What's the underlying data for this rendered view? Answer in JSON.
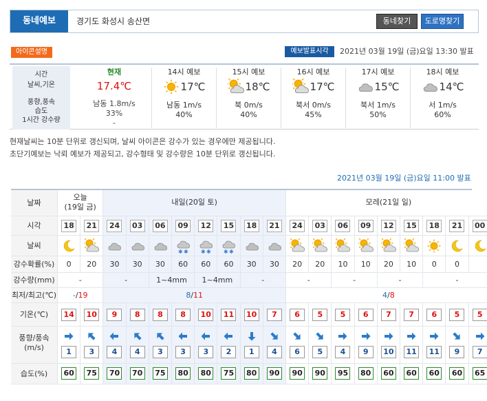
{
  "header": {
    "label": "동네예보",
    "location": "경기도 화성시 송산면",
    "btn_find": "동네찾기",
    "btn_road": "도로명찾기"
  },
  "icon_help": "아이콘설명",
  "pub_tag": "예보발표시각",
  "pub_time": "2021년 03월 19일 (금)요일 13:30 발표",
  "current": {
    "labels": [
      "시간",
      "날씨,기온",
      "풍향,풍속",
      "습도",
      "1시간 강수량"
    ],
    "now": {
      "title": "현재",
      "temp": "17.4℃",
      "wind": "남동 1.8m/s",
      "humidity": "33%",
      "rain": "-"
    },
    "forecasts": [
      {
        "title": "14시 예보",
        "icon": "sun-icon",
        "temp": "17℃",
        "wind": "남동 1m/s",
        "humidity": "40%"
      },
      {
        "title": "15시 예보",
        "icon": "partly-cloudy-icon",
        "temp": "18℃",
        "wind": "북 0m/s",
        "humidity": "40%"
      },
      {
        "title": "16시 예보",
        "icon": "partly-cloudy-icon",
        "temp": "17℃",
        "wind": "북서 0m/s",
        "humidity": "45%"
      },
      {
        "title": "17시 예보",
        "icon": "cloudy-icon",
        "temp": "15℃",
        "wind": "북서 1m/s",
        "humidity": "50%"
      },
      {
        "title": "18시 예보",
        "icon": "cloudy-icon",
        "temp": "14℃",
        "wind": "서 1m/s",
        "humidity": "60%"
      }
    ]
  },
  "notes": [
    "현재날씨는 10분 단위로 갱신되며, 날씨 아이콘은 강수가 있는 경우에만 제공됩니다.",
    "초단기예보는 낙뢰 예보가 제공되고, 강수형태 및 강수량은 10분 단위로 갱신됩니다."
  ],
  "pub_time2": "2021년 03월 19일 (금)요일 11:00 발표",
  "table": {
    "row_labels": {
      "date": "날짜",
      "time": "시각",
      "weather": "날씨",
      "pop": "강수확률(%)",
      "rain": "강수량(mm)",
      "minmax": "최저/최고(℃)",
      "temp": "기온(℃)",
      "wind": "풍향/풍속(m/s)",
      "humid": "습도(%)"
    },
    "days": [
      {
        "label": "오늘",
        "sub": "(19일 금)"
      },
      {
        "label": "내일(20일 토)"
      },
      {
        "label": "모레(21일 일)"
      }
    ],
    "times": [
      "18",
      "21",
      "24",
      "03",
      "06",
      "09",
      "12",
      "15",
      "18",
      "21",
      "24",
      "03",
      "06",
      "09",
      "12",
      "15",
      "18",
      "21",
      "00"
    ],
    "weather_icons": [
      "moon-icon",
      "partly-cloudy-icon",
      "cloudy-icon",
      "cloudy-icon",
      "cloudy-icon",
      "snow-rain-icon",
      "snow-rain-icon",
      "snow-rain-icon",
      "cloudy-icon",
      "cloudy-icon",
      "partly-cloudy-icon",
      "partly-cloudy-icon",
      "partly-cloudy-icon",
      "partly-cloudy-icon",
      "partly-cloudy-icon",
      "partly-cloudy-icon",
      "sun-icon",
      "moon-icon",
      "moon-icon"
    ],
    "pop": [
      "0",
      "20",
      "30",
      "30",
      "30",
      "60",
      "60",
      "60",
      "30",
      "30",
      "20",
      "20",
      "10",
      "10",
      "20",
      "10",
      "0",
      "0",
      ""
    ],
    "rain": [
      "-",
      "-",
      "1~4mm",
      "1~4mm",
      "-",
      "-",
      "-",
      "-",
      "-"
    ],
    "minmax": {
      "today_min": "-",
      "today_max": "19",
      "tmr_min": "8",
      "tmr_max": "11",
      "dat_min": "4",
      "dat_max": "8"
    },
    "temps": [
      "14",
      "10",
      "9",
      "8",
      "8",
      "8",
      "10",
      "11",
      "10",
      "7",
      "6",
      "5",
      "5",
      "6",
      "7",
      "7",
      "6",
      "5",
      "5"
    ],
    "winds": [
      {
        "dir": "right-arrow-icon",
        "speed": "1"
      },
      {
        "dir": "up-left-arrow-icon",
        "speed": "3"
      },
      {
        "dir": "left-arrow-icon",
        "speed": "4"
      },
      {
        "dir": "up-left-arrow-icon",
        "speed": "4"
      },
      {
        "dir": "up-left-arrow-icon",
        "speed": "3"
      },
      {
        "dir": "left-arrow-icon",
        "speed": "3"
      },
      {
        "dir": "left-arrow-icon",
        "speed": "3"
      },
      {
        "dir": "left-arrow-icon",
        "speed": "2"
      },
      {
        "dir": "down-arrow-icon",
        "speed": "1"
      },
      {
        "dir": "down-right-arrow-icon",
        "speed": "4"
      },
      {
        "dir": "down-right-arrow-icon",
        "speed": "6"
      },
      {
        "dir": "down-right-arrow-icon",
        "speed": "5"
      },
      {
        "dir": "right-arrow-icon",
        "speed": "4"
      },
      {
        "dir": "right-arrow-icon",
        "speed": "9"
      },
      {
        "dir": "right-arrow-icon",
        "speed": "10"
      },
      {
        "dir": "right-arrow-icon",
        "speed": "11"
      },
      {
        "dir": "right-arrow-icon",
        "speed": "11"
      },
      {
        "dir": "down-right-arrow-icon",
        "speed": "9"
      },
      {
        "dir": "right-arrow-icon",
        "speed": "7"
      }
    ],
    "humid": [
      "60",
      "75",
      "70",
      "70",
      "75",
      "80",
      "80",
      "75",
      "80",
      "90",
      "90",
      "90",
      "95",
      "80",
      "60",
      "60",
      "60",
      "60",
      "65"
    ]
  },
  "colors": {
    "accent": "#1e6cb4",
    "temp_red": "#d11",
    "min_blue": "#1e6cb4",
    "humid_green": "#2a8a2a",
    "wind_blue": "#2c7bc9"
  }
}
